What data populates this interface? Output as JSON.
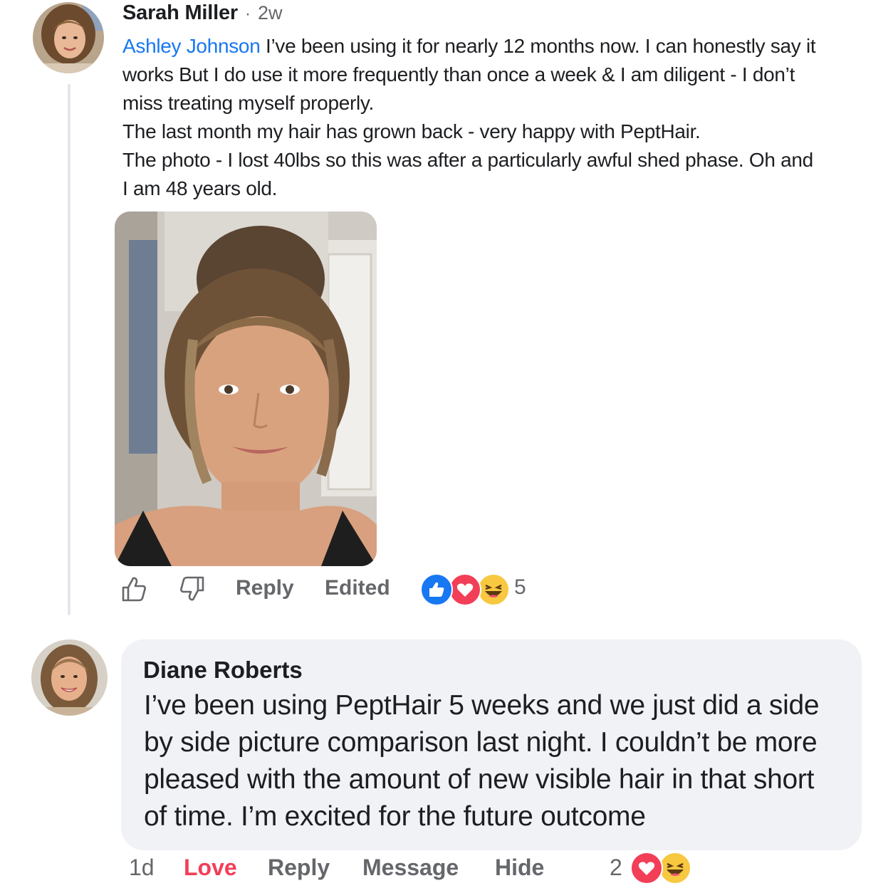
{
  "comment1": {
    "author": "Sarah Miller",
    "separator": "·",
    "time": "2w",
    "mention": "Ashley Johnson",
    "line1_rest": " I’ve been using it for nearly 12 months now. I can honestly say it",
    "lines": [
      "works But I do use it more frequently than once a week & I am diligent - I don’t",
      "miss treating myself properly.",
      "The last month my hair has grown back - very happy with PeptHair.",
      "The photo - I lost 40lbs so this was after a particularly awful shed phase. Oh and",
      "I am 48 years old."
    ],
    "actions": {
      "like_icon": "thumbs-up-outline-icon",
      "dislike_icon": "thumbs-down-outline-icon",
      "reply": "Reply",
      "edited": "Edited"
    },
    "reactions": [
      "like",
      "love",
      "haha"
    ],
    "reaction_count": "5"
  },
  "comment2": {
    "author": "Diane Roberts",
    "lines": [
      "I’ve been using PeptHair 5 weeks and we just did a side",
      "by side picture comparison last night. I couldn’t be more",
      "pleased with the amount of new visible hair in that short",
      "of time. I’m excited for the future outcome"
    ],
    "actions": {
      "time": "1d",
      "love": "Love",
      "reply": "Reply",
      "message": "Message",
      "hide": "Hide"
    },
    "reaction_count": "2",
    "reactions": [
      "love",
      "haha"
    ]
  },
  "colors": {
    "mention": "#1877f2",
    "love_action": "#f33e58",
    "bubble": "#f0f2f5",
    "secondary_text": "#65676b"
  }
}
